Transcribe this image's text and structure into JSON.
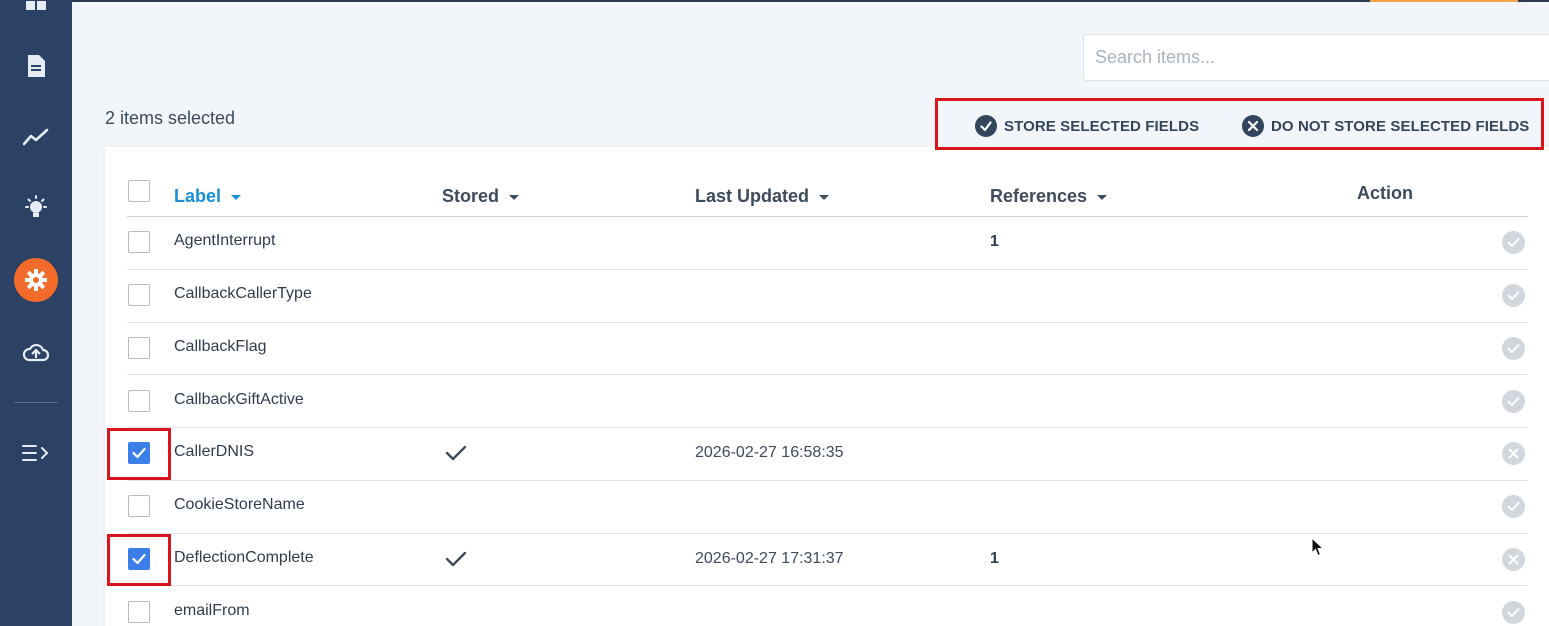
{
  "search": {
    "placeholder": "Search items..."
  },
  "selection": {
    "count_text": "2 items selected"
  },
  "bulk_actions": {
    "store_label": "STORE SELECTED FIELDS",
    "do_not_store_label": "DO NOT STORE SELECTED FIELDS"
  },
  "table": {
    "headers": {
      "label": "Label",
      "stored": "Stored",
      "last_updated": "Last Updated",
      "references": "References",
      "action": "Action"
    },
    "rows": [
      {
        "label": "AgentInterrupt",
        "checked": false,
        "stored": false,
        "last_updated": "",
        "references": "1"
      },
      {
        "label": "CallbackCallerType",
        "checked": false,
        "stored": false,
        "last_updated": "",
        "references": ""
      },
      {
        "label": "CallbackFlag",
        "checked": false,
        "stored": false,
        "last_updated": "",
        "references": ""
      },
      {
        "label": "CallbackGiftActive",
        "checked": false,
        "stored": false,
        "last_updated": "",
        "references": ""
      },
      {
        "label": "CallerDNIS",
        "checked": true,
        "stored": true,
        "last_updated": "2026-02-27 16:58:35",
        "references": ""
      },
      {
        "label": "CookieStoreName",
        "checked": false,
        "stored": false,
        "last_updated": "",
        "references": ""
      },
      {
        "label": "DeflectionComplete",
        "checked": true,
        "stored": true,
        "last_updated": "2026-02-27 17:31:37",
        "references": "1"
      },
      {
        "label": "emailFrom",
        "checked": false,
        "stored": false,
        "last_updated": "",
        "references": ""
      }
    ]
  },
  "colors": {
    "sidebar": "#2b4264",
    "active_nav": "#f26b2a",
    "accent_blue": "#1a8fd6",
    "checkbox_blue": "#3b7ee8",
    "highlight_red": "#d8141d"
  }
}
